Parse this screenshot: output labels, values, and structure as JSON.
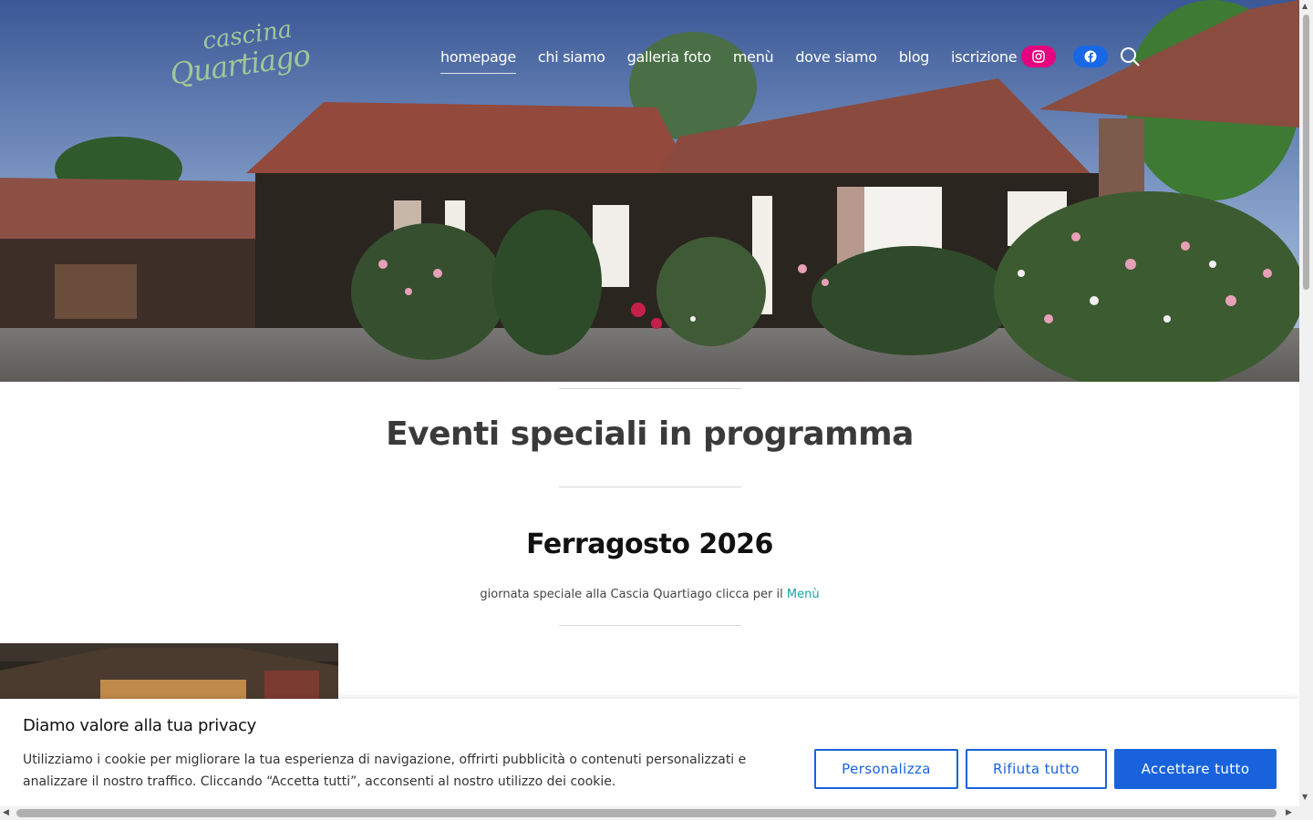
{
  "header": {
    "logo_line1": "cascina",
    "logo_line2": "Quartiago",
    "nav": [
      {
        "label": "homepage",
        "active": true
      },
      {
        "label": "chi siamo"
      },
      {
        "label": "galleria foto"
      },
      {
        "label": "menù"
      },
      {
        "label": "dove siamo"
      },
      {
        "label": "blog"
      },
      {
        "label": "iscrizione"
      }
    ],
    "social": {
      "instagram_icon": "instagram-icon",
      "facebook_icon": "facebook-icon"
    },
    "search_icon": "search-icon"
  },
  "main": {
    "section_title": "Eventi speciali in programma",
    "event": {
      "title": "Ferragosto 2026",
      "description": "giornata speciale alla Cascia Quartiago clicca per il",
      "link_label": "Menù"
    }
  },
  "cookie_banner": {
    "title": "Diamo valore alla tua privacy",
    "text": "Utilizziamo i cookie per migliorare la tua esperienza di navigazione, offrirti pubblicità o contenuti personalizzati e analizzare il nostro traffico. Cliccando “Accetta tutti”, acconsenti al nostro utilizzo dei cookie.",
    "buttons": {
      "customize": "Personalizza",
      "reject": "Rifiuta tutto",
      "accept": "Accettare tutto"
    }
  },
  "colors": {
    "instagram": "#e4007f",
    "facebook": "#1868e6",
    "primary_button": "#1863dc",
    "link": "#1aa3a3"
  }
}
